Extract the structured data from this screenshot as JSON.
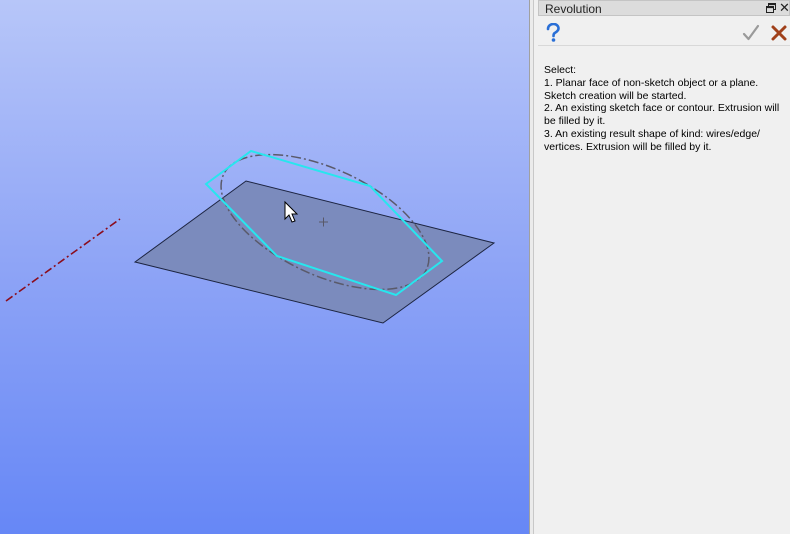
{
  "panel": {
    "title": "Revolution",
    "help_text": "Select:\n1. Planar face of non-sketch object or a plane. Sketch creation will be started.\n2. An existing sketch face or contour. Extrusion will be filled by it.\n3. An existing result shape of kind: wires/edge/ vertices. Extrusion will be filled by it."
  },
  "icons": {
    "float": "float-window-icon",
    "close": "close-icon",
    "help": "help-question-icon",
    "ok": "checkmark-icon",
    "cancel": "cancel-x-icon"
  },
  "colors": {
    "viewport_top": "#b7c6f9",
    "viewport_bottom": "#6687f6",
    "plane_fill": "#7b8bbd",
    "highlight": "#27e6ee",
    "axis": "#8b0d1d"
  }
}
